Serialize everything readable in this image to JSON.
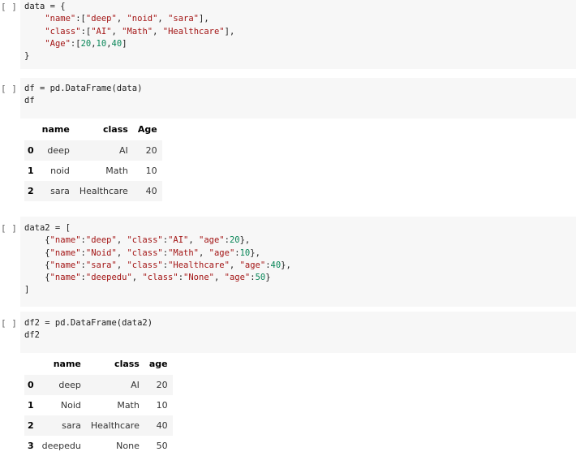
{
  "run_label": "[ ]",
  "cell1": {
    "lines": [
      [
        {
          "t": "data = {"
        }
      ],
      [
        {
          "t": "    "
        },
        {
          "t": "\"name\"",
          "c": "s"
        },
        {
          "t": ":["
        },
        {
          "t": "\"deep\"",
          "c": "s"
        },
        {
          "t": ", "
        },
        {
          "t": "\"noid\"",
          "c": "s"
        },
        {
          "t": ", "
        },
        {
          "t": "\"sara\"",
          "c": "s"
        },
        {
          "t": "],"
        }
      ],
      [
        {
          "t": "    "
        },
        {
          "t": "\"class\"",
          "c": "s"
        },
        {
          "t": ":["
        },
        {
          "t": "\"AI\"",
          "c": "s"
        },
        {
          "t": ", "
        },
        {
          "t": "\"Math\"",
          "c": "s"
        },
        {
          "t": ", "
        },
        {
          "t": "\"Healthcare\"",
          "c": "s"
        },
        {
          "t": "],"
        }
      ],
      [
        {
          "t": "    "
        },
        {
          "t": "\"Age\"",
          "c": "s"
        },
        {
          "t": ":["
        },
        {
          "t": "20",
          "c": "n"
        },
        {
          "t": ","
        },
        {
          "t": "10",
          "c": "n"
        },
        {
          "t": ","
        },
        {
          "t": "40",
          "c": "n"
        },
        {
          "t": "]"
        }
      ],
      [
        {
          "t": "}"
        }
      ]
    ]
  },
  "cell2": {
    "lines": [
      [
        {
          "t": "df = pd.DataFrame(data)"
        }
      ],
      [
        {
          "t": "df"
        }
      ]
    ],
    "table": {
      "columns": [
        "name",
        "class",
        "Age"
      ],
      "rows": [
        {
          "index": "0",
          "values": [
            "deep",
            "AI",
            "20"
          ]
        },
        {
          "index": "1",
          "values": [
            "noid",
            "Math",
            "10"
          ]
        },
        {
          "index": "2",
          "values": [
            "sara",
            "Healthcare",
            "40"
          ]
        }
      ]
    }
  },
  "cell3": {
    "lines": [
      [
        {
          "t": "data2 = ["
        }
      ],
      [
        {
          "t": "    {"
        },
        {
          "t": "\"name\"",
          "c": "s"
        },
        {
          "t": ":"
        },
        {
          "t": "\"deep\"",
          "c": "s"
        },
        {
          "t": ", "
        },
        {
          "t": "\"class\"",
          "c": "s"
        },
        {
          "t": ":"
        },
        {
          "t": "\"AI\"",
          "c": "s"
        },
        {
          "t": ", "
        },
        {
          "t": "\"age\"",
          "c": "s"
        },
        {
          "t": ":"
        },
        {
          "t": "20",
          "c": "n"
        },
        {
          "t": "},"
        }
      ],
      [
        {
          "t": "    {"
        },
        {
          "t": "\"name\"",
          "c": "s"
        },
        {
          "t": ":"
        },
        {
          "t": "\"Noid\"",
          "c": "s"
        },
        {
          "t": ", "
        },
        {
          "t": "\"class\"",
          "c": "s"
        },
        {
          "t": ":"
        },
        {
          "t": "\"Math\"",
          "c": "s"
        },
        {
          "t": ", "
        },
        {
          "t": "\"age\"",
          "c": "s"
        },
        {
          "t": ":"
        },
        {
          "t": "10",
          "c": "n"
        },
        {
          "t": "},"
        }
      ],
      [
        {
          "t": "    {"
        },
        {
          "t": "\"name\"",
          "c": "s"
        },
        {
          "t": ":"
        },
        {
          "t": "\"sara\"",
          "c": "s"
        },
        {
          "t": ", "
        },
        {
          "t": "\"class\"",
          "c": "s"
        },
        {
          "t": ":"
        },
        {
          "t": "\"Healthcare\"",
          "c": "s"
        },
        {
          "t": ", "
        },
        {
          "t": "\"age\"",
          "c": "s"
        },
        {
          "t": ":"
        },
        {
          "t": "40",
          "c": "n"
        },
        {
          "t": "},"
        }
      ],
      [
        {
          "t": "    {"
        },
        {
          "t": "\"name\"",
          "c": "s"
        },
        {
          "t": ":"
        },
        {
          "t": "\"deepedu\"",
          "c": "s"
        },
        {
          "t": ", "
        },
        {
          "t": "\"class\"",
          "c": "s"
        },
        {
          "t": ":"
        },
        {
          "t": "\"None\"",
          "c": "s"
        },
        {
          "t": ", "
        },
        {
          "t": "\"age\"",
          "c": "s"
        },
        {
          "t": ":"
        },
        {
          "t": "50",
          "c": "n"
        },
        {
          "t": "}"
        }
      ],
      [
        {
          "t": "]"
        }
      ]
    ]
  },
  "cell4": {
    "lines": [
      [
        {
          "t": "df2 = pd.DataFrame(data2)"
        }
      ],
      [
        {
          "t": "df2"
        }
      ]
    ],
    "table": {
      "columns": [
        "name",
        "class",
        "age"
      ],
      "rows": [
        {
          "index": "0",
          "values": [
            "deep",
            "AI",
            "20"
          ]
        },
        {
          "index": "1",
          "values": [
            "Noid",
            "Math",
            "10"
          ]
        },
        {
          "index": "2",
          "values": [
            "sara",
            "Healthcare",
            "40"
          ]
        },
        {
          "index": "3",
          "values": [
            "deepedu",
            "None",
            "50"
          ]
        }
      ]
    }
  },
  "colors": {
    "string": "#a31515",
    "number": "#098658",
    "code_bg": "#f7f7f7",
    "row_alt": "#f5f5f5"
  }
}
